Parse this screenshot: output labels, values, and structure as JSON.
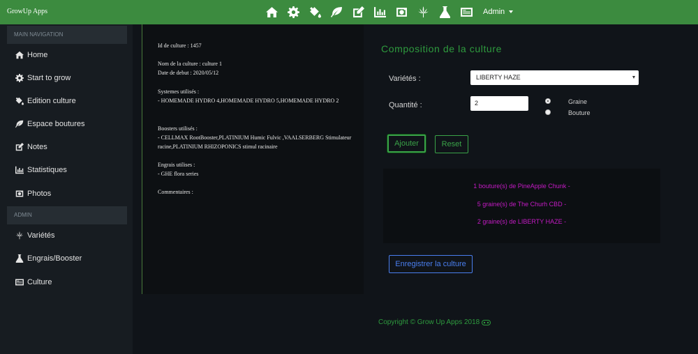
{
  "app": {
    "brand": "GrowUp Apps"
  },
  "topnav": {
    "icons": [
      "home-icon",
      "gear-icon",
      "paint-bucket-icon",
      "leaf-icon",
      "edit-icon",
      "bar-chart-icon",
      "camera-icon",
      "cannabis-leaf-icon",
      "flask-icon",
      "id-card-icon"
    ],
    "admin_label": "Admin"
  },
  "sidebar": {
    "main_header": "MAIN NAVIGATION",
    "items": [
      {
        "label": "Home",
        "icon": "home-icon"
      },
      {
        "label": "Start to grow",
        "icon": "gear-icon"
      },
      {
        "label": "Edition culture",
        "icon": "paint-bucket-icon"
      },
      {
        "label": "Espace boutures",
        "icon": "leaf-icon"
      },
      {
        "label": "Notes",
        "icon": "edit-icon"
      },
      {
        "label": "Statistiques",
        "icon": "bar-chart-icon"
      },
      {
        "label": "Photos",
        "icon": "camera-icon"
      }
    ],
    "admin_header": "ADMIN",
    "admin_items": [
      {
        "label": "Variétés",
        "icon": "cannabis-leaf-icon"
      },
      {
        "label": "Engrais/Booster",
        "icon": "flask-icon"
      },
      {
        "label": "Culture",
        "icon": "id-card-icon"
      }
    ]
  },
  "info": {
    "id": "Id de culture : 1457",
    "nom": "Nom de la culture : culture 1",
    "date": "Date de debut : 2020/05/12",
    "systemes_title": "Systemes utilisés :",
    "systemes": "- HOMEMADE HYDRO 4,HOMEMADE HYDRO 5,HOMEMADE HYDRO 2",
    "boosters_title": "Boosters utilisés :",
    "boosters": "- CELLMAX RootBooster,PLATINIUM Humic Fulvic ,VAALSERBERG Stimulateur racine,PLATINIUM RHIZOPONICS stimul racinaire",
    "engrais_title": "Engrais utilises :",
    "engrais": "- GHE flora series",
    "commentaires": "Commentaires :"
  },
  "form": {
    "title": "Composition de la culture",
    "varietes_label": "Variétés :",
    "varietes_value": "LIBERTY HAZE",
    "quantite_label": "Quantité :",
    "quantite_value": "2",
    "radio_graine": "Graine",
    "radio_bouture": "Bouture",
    "add_label": "Ajouter",
    "reset_label": "Reset",
    "results": [
      "1 bouture(s) de PineApple Chunk -",
      "5 graine(s) de The Churh CBD -",
      "2 graine(s) de LIBERTY HAZE -"
    ],
    "save_label": "Enregistrer la culture"
  },
  "colors": {
    "topbar": "#3c8b3f",
    "accent_green": "#2e9b3e",
    "result_text": "#c41bc4",
    "save_blue": "#4a7ff0"
  },
  "footer": {
    "copyright": "Copyright © Grow Up Apps 2018"
  }
}
